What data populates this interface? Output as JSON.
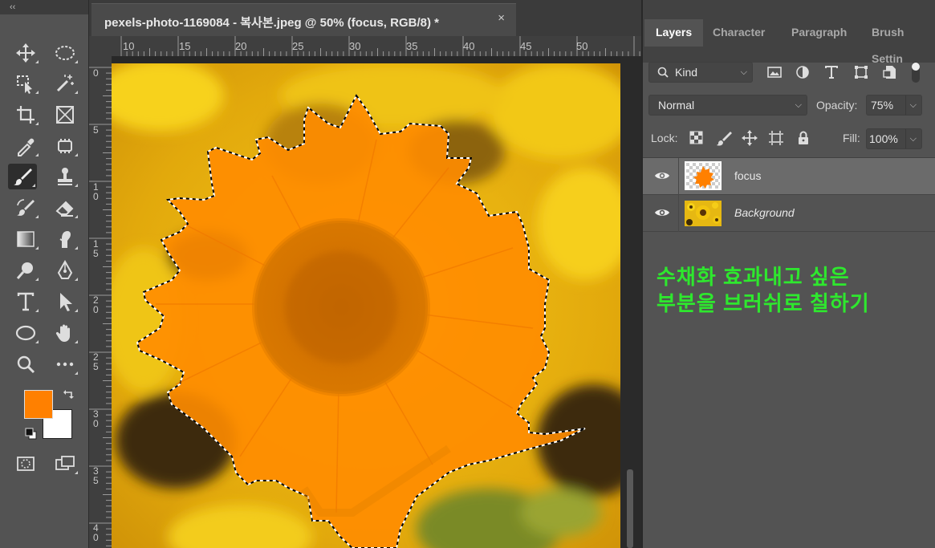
{
  "tools_panel": {
    "collapse_label": "‹‹",
    "tools": [
      {
        "name": "move-tool",
        "icon": "move-icon"
      },
      {
        "name": "marquee-tool",
        "icon": "ellipse-marquee-icon"
      },
      {
        "name": "lasso-tool",
        "icon": "object-select-icon"
      },
      {
        "name": "magic-wand-tool",
        "icon": "magic-wand-icon"
      },
      {
        "name": "crop-tool",
        "icon": "crop-icon"
      },
      {
        "name": "frame-tool",
        "icon": "frame-icon"
      },
      {
        "name": "eyedropper-tool",
        "icon": "eyedropper-icon"
      },
      {
        "name": "patch-tool",
        "icon": "patch-icon"
      },
      {
        "name": "brush-tool",
        "icon": "brush-icon",
        "active": true
      },
      {
        "name": "stamp-tool",
        "icon": "stamp-icon"
      },
      {
        "name": "history-brush-tool",
        "icon": "history-brush-icon"
      },
      {
        "name": "eraser-tool",
        "icon": "eraser-icon"
      },
      {
        "name": "gradient-tool",
        "icon": "gradient-icon"
      },
      {
        "name": "smudge-tool",
        "icon": "smudge-icon"
      },
      {
        "name": "dodge-tool",
        "icon": "dodge-icon"
      },
      {
        "name": "pen-tool",
        "icon": "pen-icon"
      },
      {
        "name": "type-tool",
        "icon": "type-icon"
      },
      {
        "name": "path-select-tool",
        "icon": "arrow-icon"
      },
      {
        "name": "shape-tool",
        "icon": "ellipse-shape-icon"
      },
      {
        "name": "hand-tool",
        "icon": "hand-icon"
      },
      {
        "name": "zoom-tool",
        "icon": "zoom-icon"
      },
      {
        "name": "more-tools",
        "icon": "ellipsis-icon"
      }
    ],
    "foreground_color": "#ff8000",
    "background_color": "#ffffff"
  },
  "document": {
    "tab_title": "pexels-photo-1169084 - 복사본.jpeg @ 50% (focus, RGB/8) *",
    "close_glyph": "×"
  },
  "rulers": {
    "horizontal": [
      "10",
      "15",
      "20",
      "25",
      "30",
      "35",
      "40",
      "45",
      "50"
    ],
    "vertical": [
      "0",
      "5",
      "10",
      "15",
      "20",
      "25",
      "30",
      "35",
      "40"
    ]
  },
  "layers_panel": {
    "tabs": [
      "Layers",
      "Character",
      "Paragraph",
      "Brush Settin"
    ],
    "active_tab": "Layers",
    "filter": {
      "value": "Kind",
      "icon": "search-icon"
    },
    "blend_mode": "Normal",
    "opacity_label": "Opacity:",
    "opacity_value": "75%",
    "lock_label": "Lock:",
    "fill_label": "Fill:",
    "fill_value": "100%",
    "layers": [
      {
        "name": "focus",
        "selected": true,
        "visible": true
      },
      {
        "name": "Background",
        "selected": false,
        "visible": true
      }
    ]
  },
  "annotation": {
    "line1": "수채화 효과내고 싶은",
    "line2": "부분을 브러쉬로 칠하기",
    "color": "#2ee82e"
  }
}
